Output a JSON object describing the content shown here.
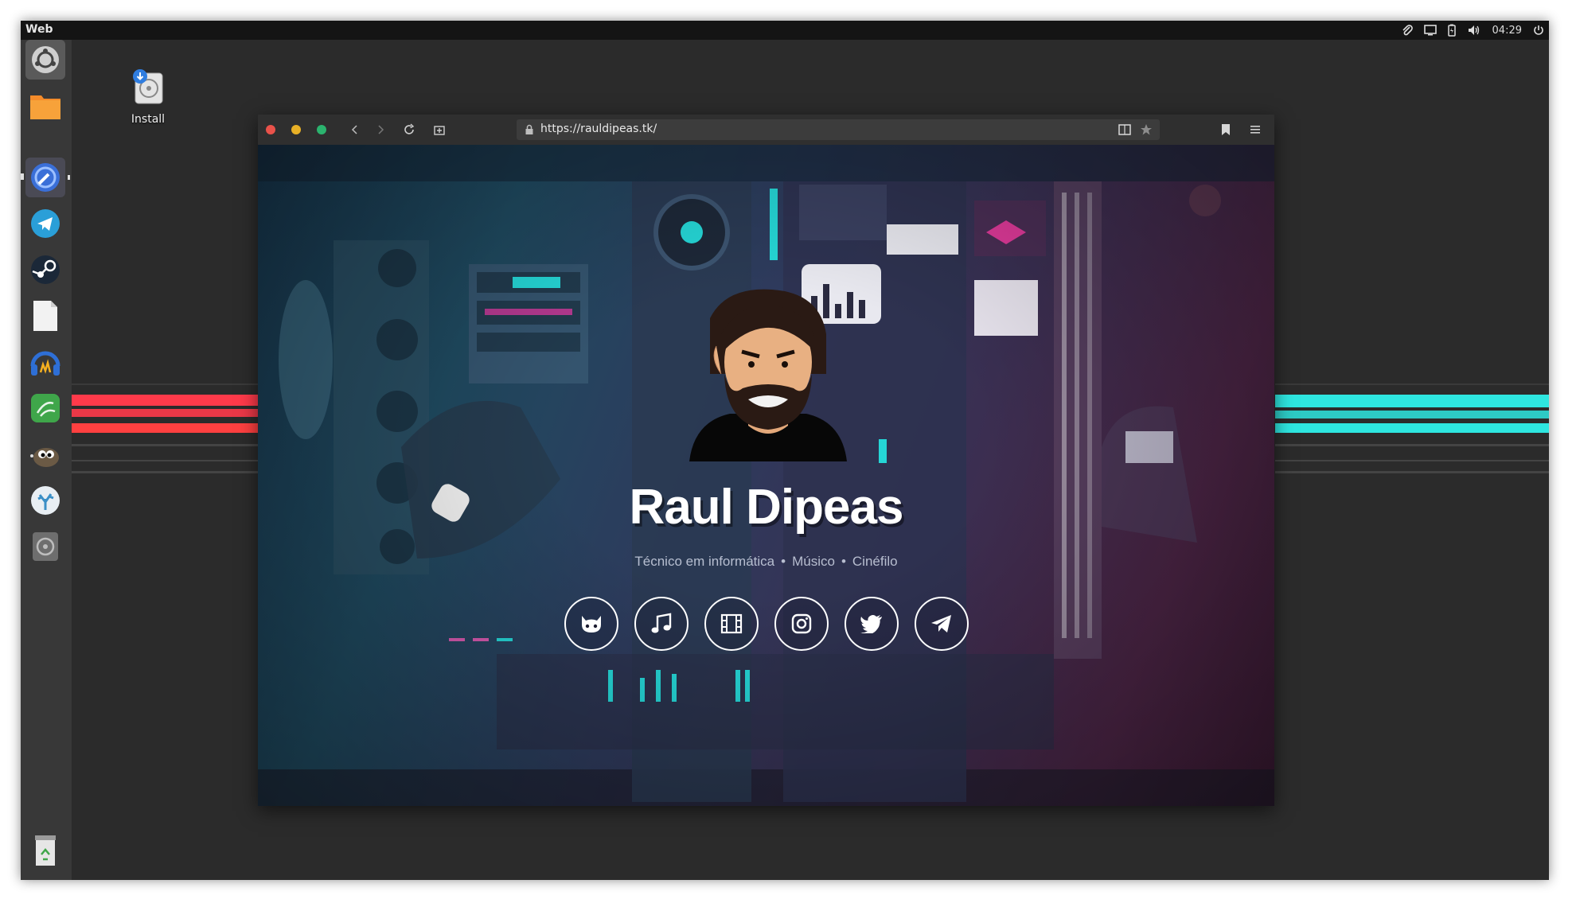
{
  "panel": {
    "app_name": "Web",
    "clock": "04:29"
  },
  "desktop": {
    "install_label": "Install"
  },
  "launcher": {
    "items": [
      "ubuntu-icon",
      "files-icon",
      "web-browser-icon",
      "telegram-icon",
      "steam-icon",
      "text-editor-icon",
      "audacity-icon",
      "tweak-tool-icon",
      "gimp-icon",
      "coral-icon",
      "disc-icon",
      "trash-icon"
    ]
  },
  "browser": {
    "url": "https://rauldipeas.tk/"
  },
  "page": {
    "name": "Raul Dipeas",
    "taglines": [
      "Técnico em informática",
      "Músico",
      "Cinéfilo"
    ],
    "separator": "•",
    "socials": [
      "github-icon",
      "music-icon",
      "film-icon",
      "instagram-icon",
      "twitter-icon",
      "telegram-icon"
    ]
  },
  "colors": {
    "stripe_left": "#ff3a3a",
    "stripe_right": "#2ee6e0",
    "accent_cyan": "#25d6d6"
  }
}
